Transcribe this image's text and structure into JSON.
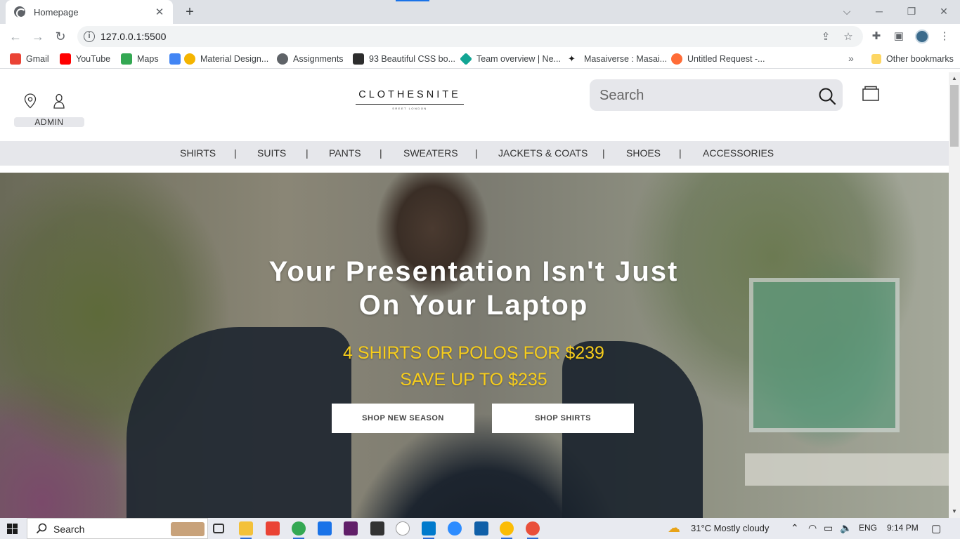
{
  "browser": {
    "tab_title": "Homepage",
    "tab_close": "✕",
    "new_tab": "+",
    "url": "127.0.0.1:5500",
    "bookmarks": [
      {
        "label": "Gmail",
        "color": "#ea4335"
      },
      {
        "label": "YouTube",
        "color": "#ff0000"
      },
      {
        "label": "Maps",
        "color": "#34a853"
      },
      {
        "label": "Material Design...",
        "color": "#f4b400"
      },
      {
        "label": "Assignments",
        "color": "#5f6368"
      },
      {
        "label": "93 Beautiful CSS bo...",
        "color": "#2d2d2d"
      },
      {
        "label": "Team overview | Ne...",
        "color": "#12a594"
      },
      {
        "label": "Masaiverse : Masai...",
        "color": "#1b1b1b"
      },
      {
        "label": "Untitled Request -...",
        "color": "#ff6c37"
      }
    ],
    "other_bookmarks": "Other bookmarks",
    "more_bookmarks": "»"
  },
  "site": {
    "admin_label": "ADMIN",
    "logo": "CLOTHESNITE",
    "logo_sub": "SREET LONDON",
    "search_placeholder": "Search",
    "categories": [
      "SHIRTS",
      "SUITS",
      "PANTS",
      "SWEATERS",
      "JACKETS & COATS",
      "SHOES",
      "ACCESSORIES"
    ],
    "separator": "|",
    "hero": {
      "title_line1": "Your Presentation Isn't Just",
      "title_line2": "On Your Laptop",
      "offer_line1": "4 SHIRTS OR POLOS FOR $239",
      "offer_line2": "SAVE UP TO $235",
      "button_primary": "SHOP NEW SEASON",
      "button_secondary": "SHOP SHIRTS"
    }
  },
  "taskbar": {
    "search_label": "Search",
    "weather": "31°C  Mostly cloudy",
    "language": "ENG",
    "time": "9:14 PM"
  },
  "colors": {
    "accent_yellow": "#f7cd1c",
    "nav_bg": "#e6e7eb",
    "chrome_tab_bg": "#dee1e6"
  }
}
